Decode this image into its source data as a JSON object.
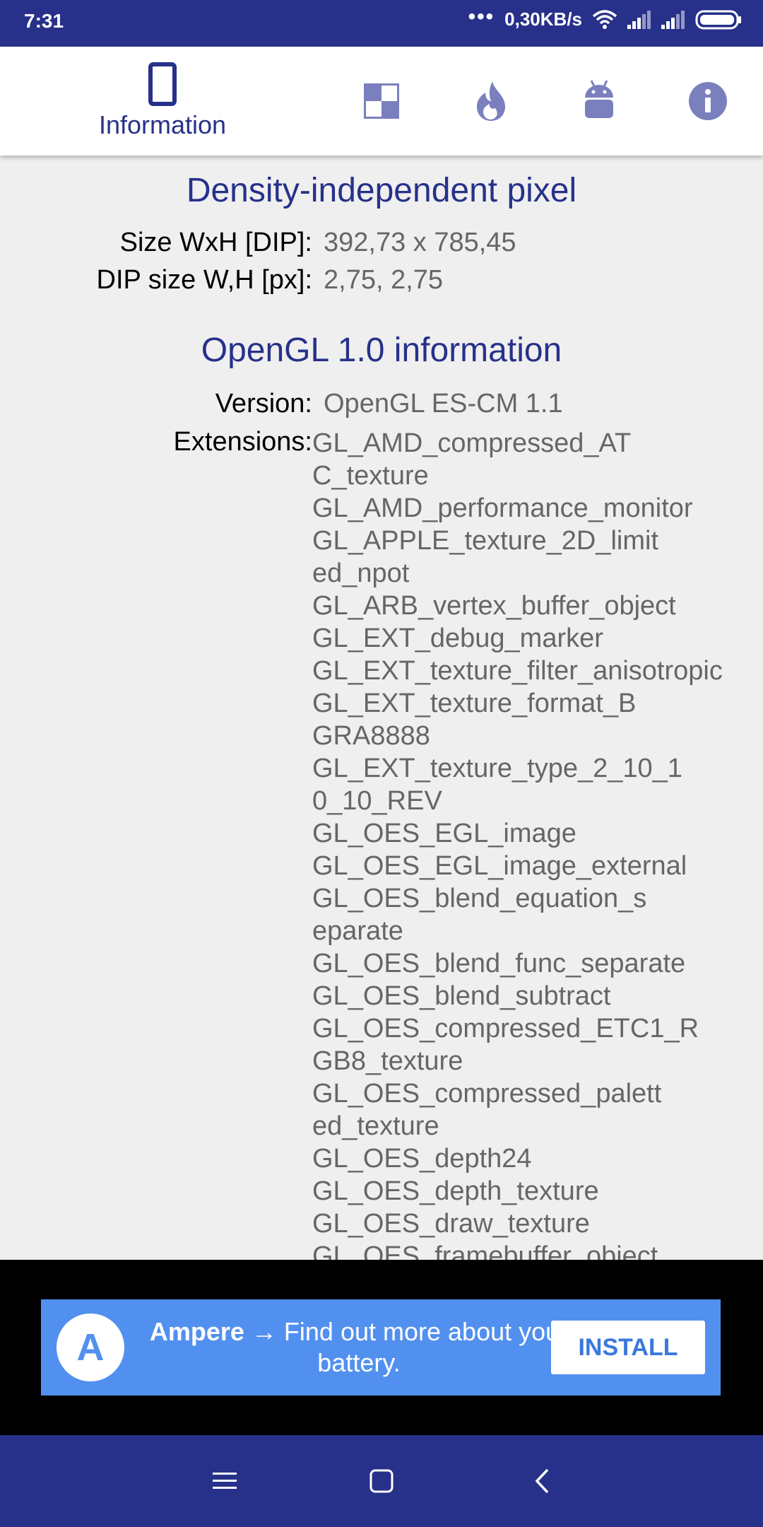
{
  "status": {
    "time": "7:31",
    "speed": "0,30KB/s"
  },
  "tabs": {
    "active_label": "Information"
  },
  "dip": {
    "title": "Density-independent pixel",
    "rows": [
      {
        "label": "Size WxH [DIP]:",
        "value": "392,73 x 785,45"
      },
      {
        "label": "DIP size W,H [px]:",
        "value": "2,75, 2,75"
      }
    ]
  },
  "opengl": {
    "title": "OpenGL 1.0 information",
    "version_label": "Version:",
    "version_value": "OpenGL ES-CM 1.1",
    "extensions_label": "Extensions:",
    "extensions_lines": [
      "GL_AMD_compressed_AT",
      "C_texture",
      "GL_AMD_performance_monitor",
      "GL_APPLE_texture_2D_limit",
      "ed_npot",
      "GL_ARB_vertex_buffer_object",
      "GL_EXT_debug_marker",
      "GL_EXT_texture_filter_anisotropic",
      "GL_EXT_texture_format_B",
      "GRA8888",
      "GL_EXT_texture_type_2_10_1",
      "0_10_REV",
      "GL_OES_EGL_image",
      "GL_OES_EGL_image_external",
      "GL_OES_blend_equation_s",
      "eparate",
      "GL_OES_blend_func_separate",
      "GL_OES_blend_subtract",
      "GL_OES_compressed_ETC1_R",
      "GB8_texture",
      "GL_OES_compressed_palett",
      "ed_texture",
      "GL_OES_depth24",
      "GL_OES_depth_texture",
      "GL_OES_draw_texture",
      "GL_OES_framebuffer_object"
    ]
  },
  "ad": {
    "logo_letter": "A",
    "brand": "Ampere",
    "text": "→ Find out more about your battery.",
    "install_label": "INSTALL"
  },
  "colors": {
    "primary": "#27318a",
    "ad_bg": "#5290ef",
    "background": "#efefef"
  }
}
